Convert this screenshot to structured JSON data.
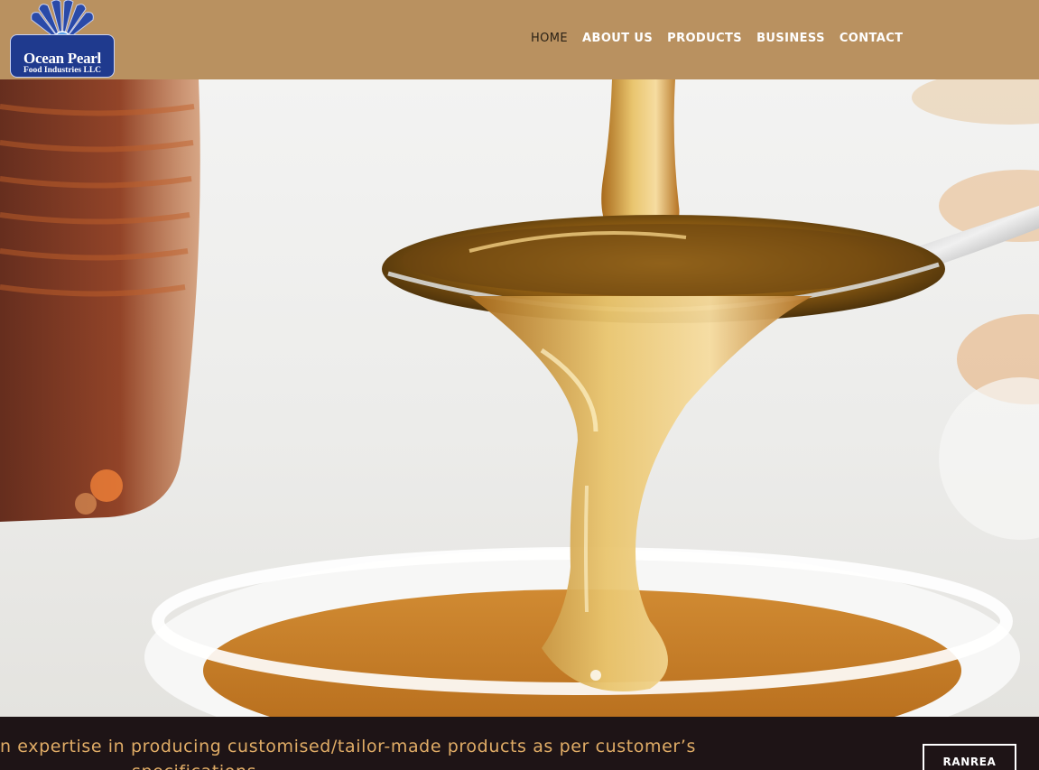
{
  "brand": {
    "name": "Ocean Pearl",
    "subtitle": "Food Industries LLC",
    "colors": {
      "header": "#b99160",
      "badge": "#1f3a8e",
      "band": "#1e1416",
      "band_text": "#e0ac66"
    }
  },
  "nav": {
    "items": [
      {
        "label": "HOME"
      },
      {
        "label": "ABOUT US"
      },
      {
        "label": "PRODUCTS"
      },
      {
        "label": "BUSINESS"
      },
      {
        "label": "CONTACT"
      }
    ]
  },
  "hero": {
    "image": "honey-dripping-from-spoon-into-bowl"
  },
  "band": {
    "line1": "n expertise in producing customised/tailor-made products as per customer’s",
    "line2": "specifications",
    "button_label": "RANREA"
  }
}
